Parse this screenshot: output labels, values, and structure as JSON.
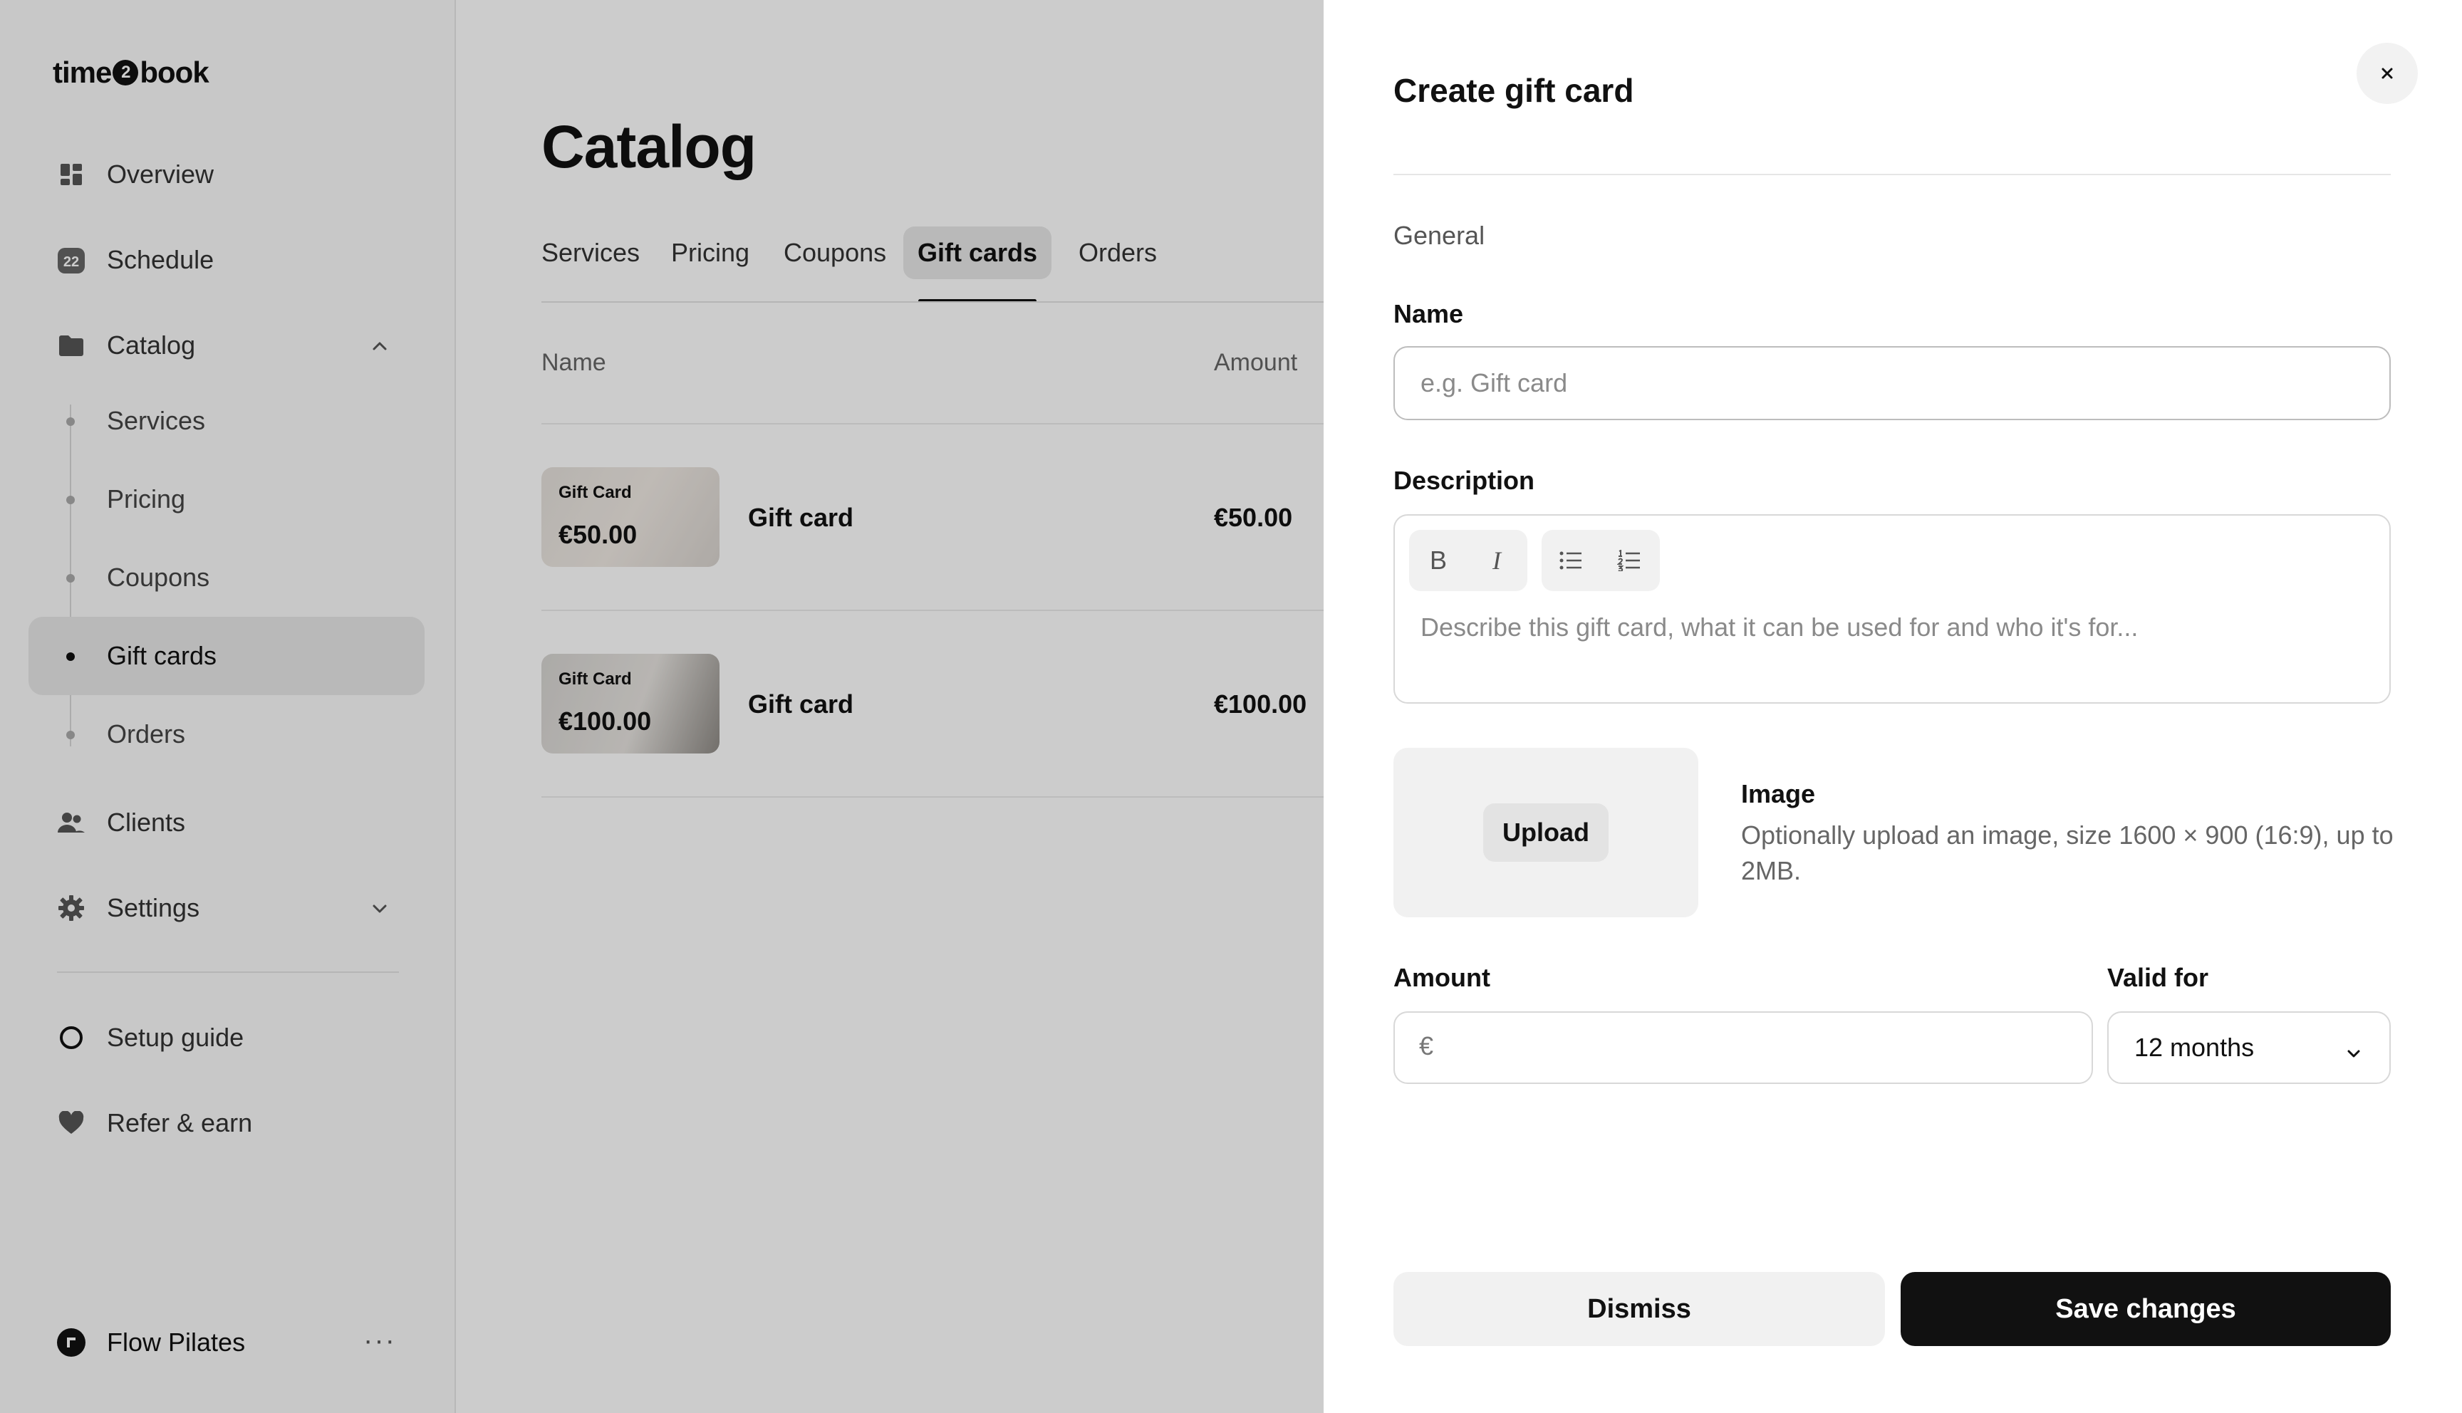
{
  "app": {
    "logo": {
      "left": "time",
      "mid": "2",
      "right": "book"
    }
  },
  "sidebar": {
    "items": [
      {
        "label": "Overview",
        "icon": "dashboard-icon"
      },
      {
        "label": "Schedule",
        "icon": "calendar-icon",
        "badge": "22"
      },
      {
        "label": "Catalog",
        "icon": "folder-icon",
        "expanded": true
      },
      {
        "label": "Clients",
        "icon": "users-icon"
      },
      {
        "label": "Settings",
        "icon": "gear-icon",
        "expanded": false
      }
    ],
    "catalog_sub": [
      {
        "label": "Services"
      },
      {
        "label": "Pricing"
      },
      {
        "label": "Coupons"
      },
      {
        "label": "Gift cards",
        "active": true
      },
      {
        "label": "Orders"
      }
    ],
    "bottom": [
      {
        "label": "Setup guide",
        "icon": "circle-icon"
      },
      {
        "label": "Refer & earn",
        "icon": "heart-icon"
      }
    ],
    "account": {
      "name": "Flow Pilates",
      "more": "···"
    }
  },
  "main": {
    "title": "Catalog",
    "tabs": [
      {
        "label": "Services"
      },
      {
        "label": "Pricing"
      },
      {
        "label": "Coupons"
      },
      {
        "label": "Gift cards",
        "active": true
      },
      {
        "label": "Orders"
      }
    ],
    "table": {
      "columns": [
        "Name",
        "Amount"
      ],
      "rows": [
        {
          "thumb_label": "Gift Card",
          "thumb_amount": "€50.00",
          "name": "Gift card",
          "amount": "€50.00"
        },
        {
          "thumb_label": "Gift Card",
          "thumb_amount": "€100.00",
          "name": "Gift card",
          "amount": "€100.00"
        }
      ]
    }
  },
  "drawer": {
    "title": "Create gift card",
    "close": "×",
    "section": "General",
    "name_label": "Name",
    "name_placeholder": "e.g. Gift card",
    "name_value": "",
    "description_label": "Description",
    "description_placeholder": "Describe this gift card, what it can be used for and who it's for...",
    "toolbar": {
      "bold": "B",
      "italic": "I"
    },
    "upload_label": "Upload",
    "image_title": "Image",
    "image_help": "Optionally upload an image, size 1600 × 900 (16:9), up to 2MB.",
    "amount_label": "Amount",
    "amount_currency": "€",
    "amount_value": "",
    "valid_label": "Valid for",
    "valid_value": "12 months",
    "dismiss_label": "Dismiss",
    "save_label": "Save changes"
  },
  "colors": {
    "primary": "#111111",
    "surface": "#f1f1f1",
    "overlay": "rgba(0,0,0,0.2)"
  }
}
